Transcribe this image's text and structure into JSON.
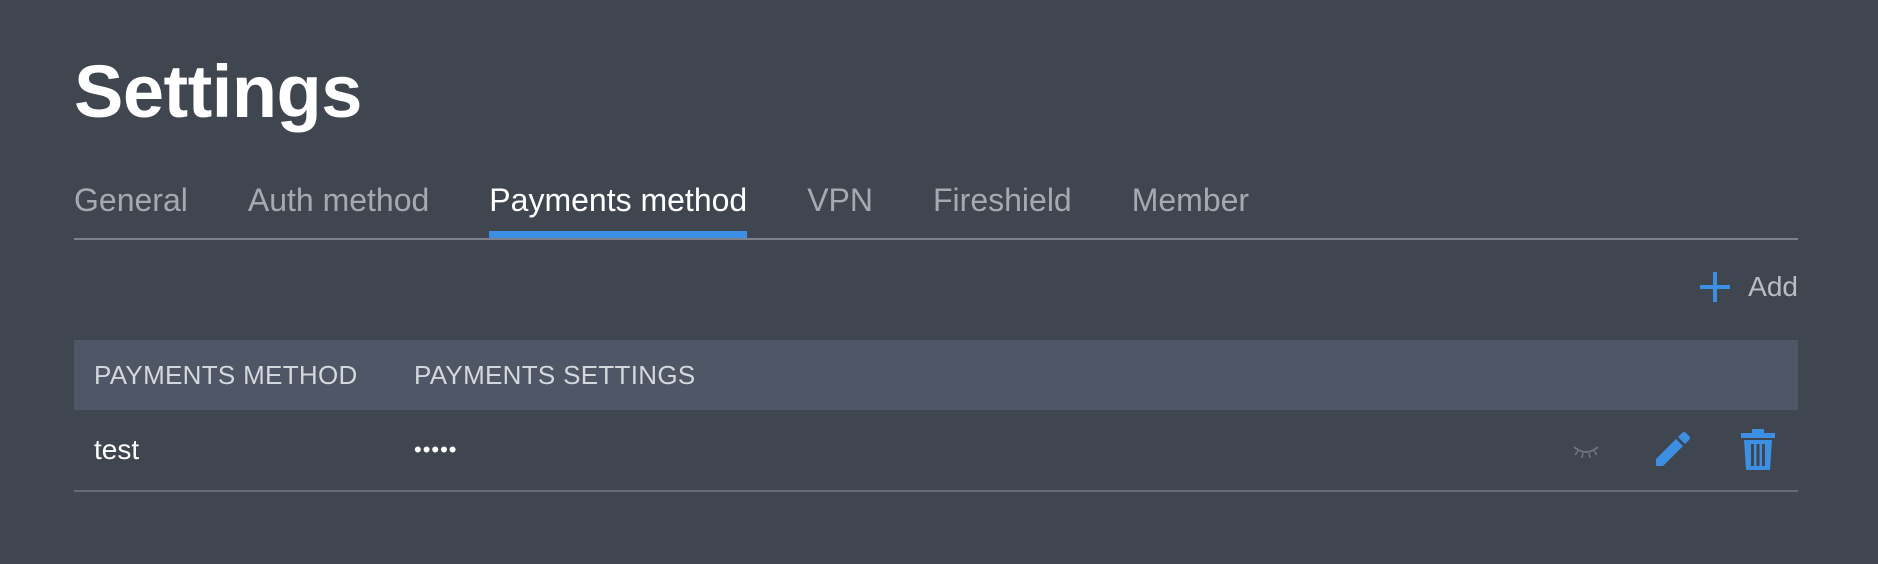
{
  "page": {
    "title": "Settings"
  },
  "tabs": [
    {
      "label": "General",
      "active": false
    },
    {
      "label": "Auth method",
      "active": false
    },
    {
      "label": "Payments method",
      "active": true
    },
    {
      "label": "VPN",
      "active": false
    },
    {
      "label": "Fireshield",
      "active": false
    },
    {
      "label": "Member",
      "active": false
    }
  ],
  "toolbar": {
    "add_label": "Add",
    "add_icon": "plus-icon"
  },
  "table": {
    "headers": [
      "PAYMENTS METHOD",
      "PAYMENTS SETTINGS"
    ],
    "rows": [
      {
        "method": "test",
        "settings": "•••••",
        "actions": [
          "eye-closed-icon",
          "pencil-icon",
          "trash-icon"
        ]
      }
    ]
  },
  "colors": {
    "background": "#404650",
    "accent": "#3d8fe4",
    "header_bg": "#4f5665",
    "muted_text": "#a5aab1"
  }
}
